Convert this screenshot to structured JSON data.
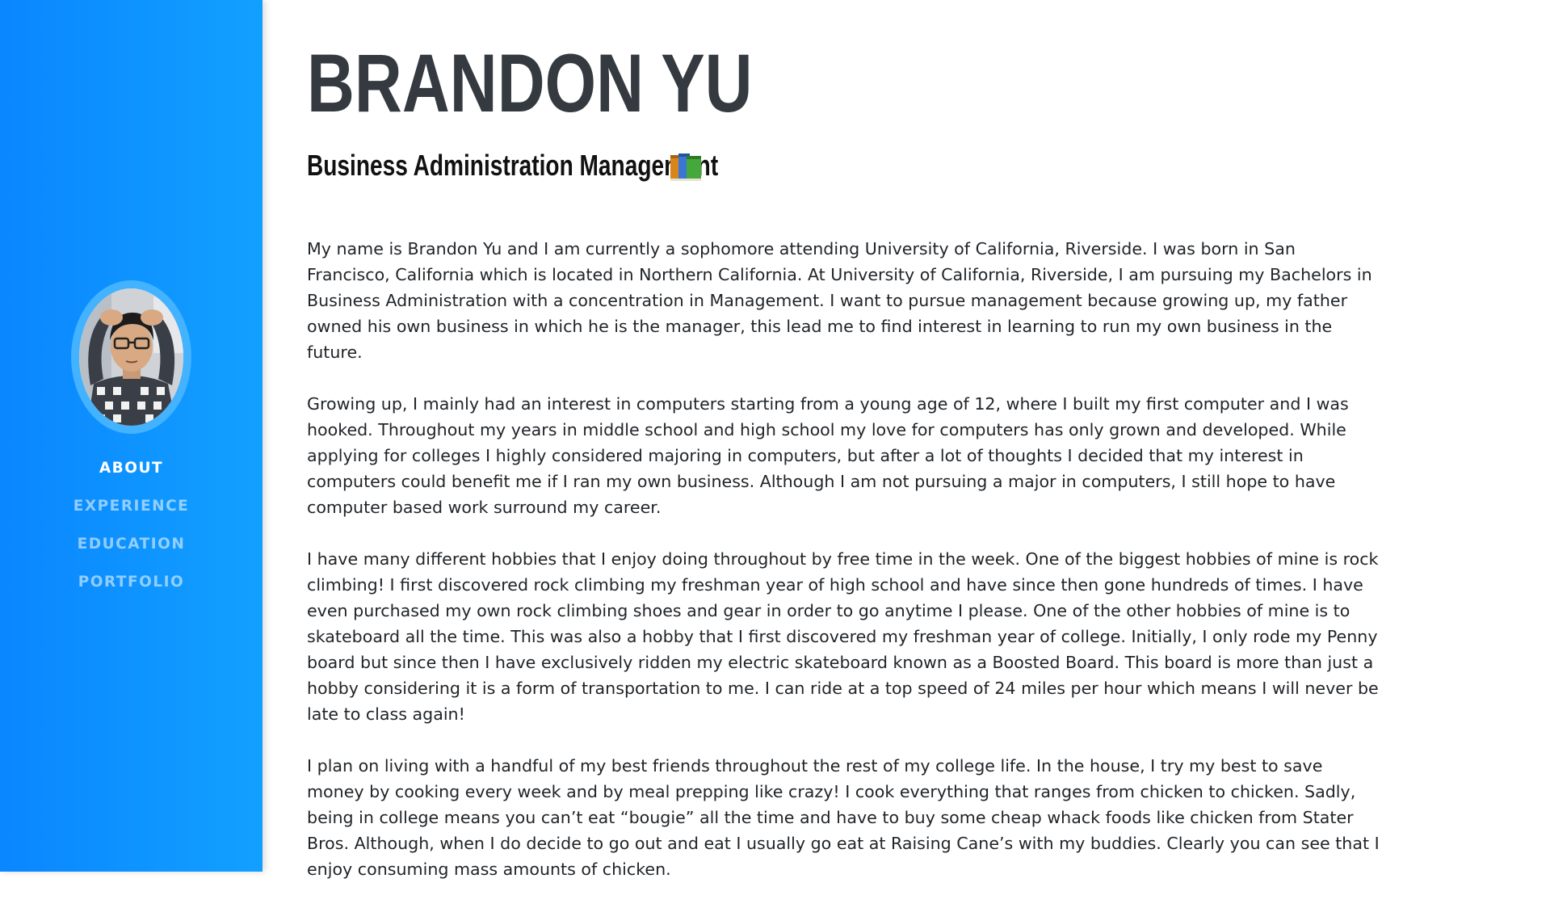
{
  "sidebar": {
    "avatar_alt": "profile photo",
    "nav": [
      {
        "label": "ABOUT",
        "active": true
      },
      {
        "label": "EXPERIENCE",
        "active": false
      },
      {
        "label": "EDUCATION",
        "active": false
      },
      {
        "label": "PORTFOLIO",
        "active": false
      }
    ]
  },
  "header": {
    "name": "BRANDON YU",
    "subtitle": "Business Administration Management",
    "subtitle_icon": "books-icon"
  },
  "bio": {
    "paragraphs": [
      "My name is Brandon Yu and I am currently a sophomore attending University of California, Riverside. I was born in San Francisco, California which is located in Northern California. At University of California, Riverside, I am pursuing my Bachelors in Business Administration with a concentration in Management. I want to pursue management because growing up, my father owned his own business in which he is the manager, this lead me to find interest in learning to run my own business in the future.",
      "Growing up, I mainly had an interest in computers starting from a young age of 12, where I built my first computer and I was hooked. Throughout my years in middle school and high school my love for computers has only grown and developed. While applying for colleges I highly considered majoring in computers, but after a lot of thoughts I decided that my interest in computers could benefit me if I ran my own business. Although I am not pursuing a major in computers, I still hope to have computer based work surround my career.",
      "I have many different hobbies that I enjoy doing throughout by free time in the week. One of the biggest hobbies of mine is rock climbing! I first discovered rock climbing my freshman year of high school and have since then gone hundreds of times. I have even purchased my own rock climbing shoes and gear in order to go anytime I please. One of the other hobbies of mine is to skateboard all the time. This was also a hobby that I first discovered my freshman year of college. Initially, I only rode my Penny board but since then I have exclusively ridden my electric skateboard known as a Boosted Board. This board is more than just a hobby considering it is a form of transportation to me. I can ride at a top speed of 24 miles per hour which means I will never be late to class again!",
      "I plan on living with a handful of my best friends throughout the rest of my college life. In the house, I try my best to save money by cooking every week and by meal prepping like crazy! I cook everything that ranges from chicken to chicken. Sadly, being in college means you can’t eat “bougie” all the time and have to buy some cheap whack foods like chicken from Stater Bros. Although, when I do decide to go out and eat I usually go eat at Raising Cane’s with my buddies. Clearly you can see that I enjoy consuming mass amounts of chicken."
    ]
  },
  "colors": {
    "sidebar_start": "#0a86ff",
    "sidebar_end": "#12a0ff",
    "heading": "#343a40",
    "text": "#212529"
  }
}
